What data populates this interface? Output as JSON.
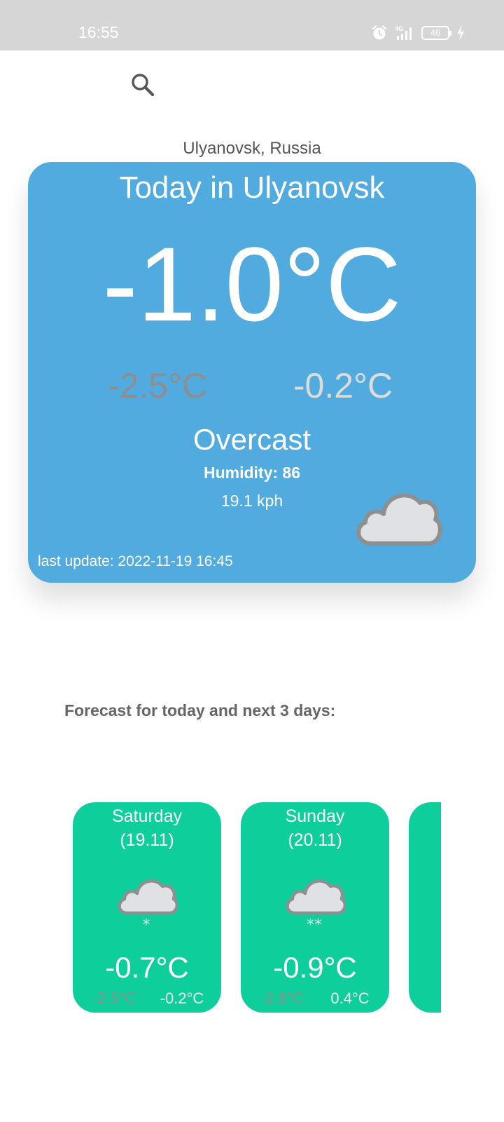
{
  "status_bar": {
    "time": "16:55",
    "battery": "46",
    "icons": [
      "alarm-icon",
      "signal-4g-icon",
      "battery-icon",
      "charging-icon"
    ]
  },
  "search": {
    "icon": "search-icon"
  },
  "location": "Ulyanovsk, Russia",
  "today": {
    "title": "Today in Ulyanovsk",
    "temp": "-1.0°C",
    "min": "-2.5°C",
    "max": "-0.2°C",
    "condition": "Overcast",
    "humidity": "Humidity: 86",
    "wind": "19.1 kph",
    "icon": "cloud-icon",
    "last_update": "last update: 2022-11-19 16:45"
  },
  "forecast_heading": "Forecast for today and next 3 days:",
  "forecast": [
    {
      "day": "Saturday",
      "date": "(19.11)",
      "icon": "light-snow-icon",
      "avg": "-0.7°C",
      "min": "-2.5°C",
      "max": "-0.2°C"
    },
    {
      "day": "Sunday",
      "date": "(20.11)",
      "icon": "snow-icon",
      "avg": "-0.9°C",
      "min": "-2.8°C",
      "max": "0.4°C"
    },
    {
      "day": "",
      "date": "",
      "icon": "",
      "avg": "",
      "min": "",
      "max": ""
    }
  ],
  "colors": {
    "status_bar": "#d6d6d6",
    "today_card": "#52abdf",
    "forecast_card": "#0ecf9b",
    "min_temp": "#8e8e8e",
    "max_temp": "#dcdcdc"
  }
}
